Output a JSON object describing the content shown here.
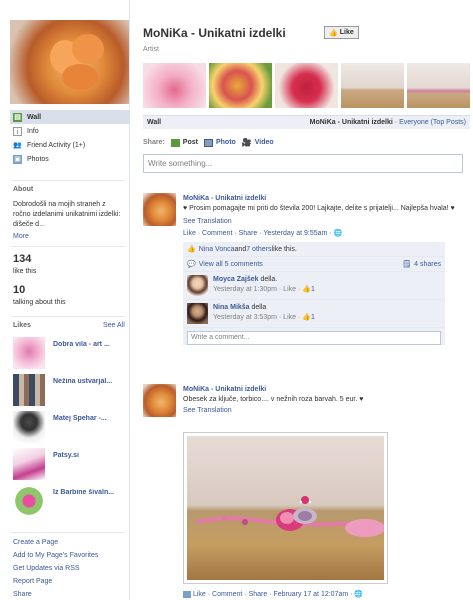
{
  "page": {
    "title": "MoNiKa - Unikatni izdelki",
    "like_button": "Like",
    "category": "Artist"
  },
  "nav": [
    {
      "label": "Wall",
      "icon": "wall-icon",
      "active": true
    },
    {
      "label": "Info",
      "icon": "info-icon"
    },
    {
      "label": "Friend Activity (1+)",
      "icon": "friends-icon"
    },
    {
      "label": "Photos",
      "icon": "photos-icon"
    }
  ],
  "about": {
    "title": "About",
    "text": "Dobrodošli na mojih straneh z ročno izdelanimi unikatnimi izdelki: dišeče d...",
    "more": "More"
  },
  "stats": {
    "likes_num": "134",
    "likes_label": "like this",
    "talking_num": "10",
    "talking_label": "talking about this"
  },
  "likes": {
    "title": "Likes",
    "see_all": "See All",
    "items": [
      {
        "name": "Dobra vila - art ..."
      },
      {
        "name": "Nežina ustvarjal..."
      },
      {
        "name": "Matej Špehar -..."
      },
      {
        "name": "Patsy.si"
      },
      {
        "name": "Iz Barbine šivaln..."
      }
    ]
  },
  "footer_links": [
    "Create a Page",
    "Add to My Page's Favorites",
    "Get Updates via RSS",
    "Report Page",
    "Share"
  ],
  "wall_bar": {
    "left": "Wall",
    "right_name": "MoNiKa - Unikatni izdelki",
    "right_sep": " · ",
    "right_filter": "Everyone (Top Posts)"
  },
  "share": {
    "label": "Share:",
    "post": "Post",
    "photo": "Photo",
    "video": "Video",
    "placeholder": "Write something..."
  },
  "story1": {
    "actor": "MoNiKa - Unikatni izdelki",
    "message": "♥ Prosim pomagajte mi priti do števila 200! Lajkajte, delite s prijatelji... Najlepša hvala! ♥",
    "see_translation": "See Translation",
    "meta": "Like · Comment · Share · Yesterday at 9:55am ·",
    "likes_prefix": "Nina Vonca",
    "likes_and": " and ",
    "likes_others": "7 others",
    "likes_suffix": " like this.",
    "view_all": "View all 5 comments",
    "shares": "4 shares",
    "comments": [
      {
        "name": "Moyca Zajšek",
        "text": " della.",
        "meta": "Yesterday at 1:30pm · Like · ",
        "likes": "1"
      },
      {
        "name": "Nina Mikša",
        "text": " della",
        "meta": "Yesterday at 3:53pm · Like · ",
        "likes": "1"
      }
    ],
    "write_comment": "Write a comment..."
  },
  "story2": {
    "actor": "MoNiKa - Unikatni izdelki",
    "message": "Obesek za ključe, torbico.... v nežnih roza barvah. 5 eur. ♥",
    "see_translation": "See Translation",
    "meta": "Like · Comment · Share · February 17 at 12:07am ·"
  },
  "colors": {
    "link": "#3b5998",
    "nav_active": "#d8dfea",
    "ufi_bg": "#eceff5"
  }
}
